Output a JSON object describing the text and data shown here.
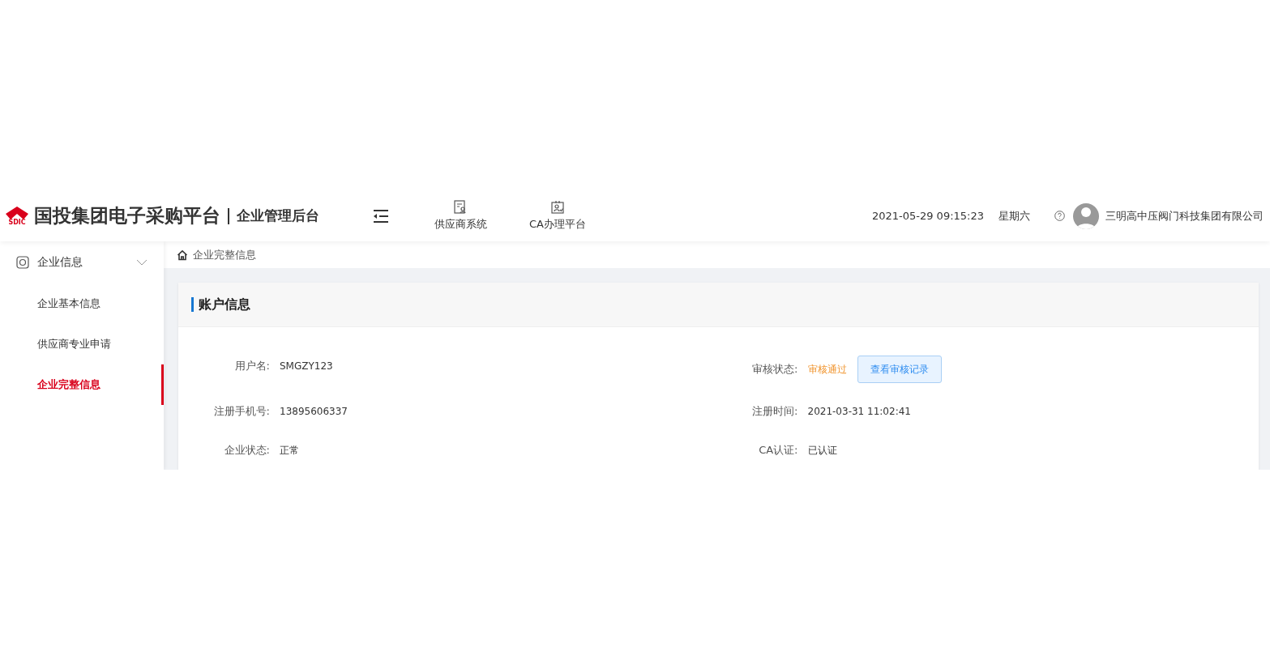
{
  "header": {
    "logo_text": "SDIC",
    "title": "国投集团电子采购平台",
    "subtitle": "企业管理后台",
    "nav": [
      {
        "label": "供应商系统",
        "kind": "supplier"
      },
      {
        "label": "CA办理平台",
        "kind": "ca"
      }
    ],
    "datetime": "2021-05-29 09:15:23",
    "weekday": "星期六",
    "company": "三明高中压阀门科技集团有限公司"
  },
  "sidebar": {
    "items": [
      {
        "label": "企业信息",
        "expanded": true,
        "children": [
          {
            "label": "企业基本信息",
            "selected": false
          },
          {
            "label": "供应商专业申请",
            "selected": false
          },
          {
            "label": "企业完整信息",
            "selected": true
          }
        ]
      }
    ]
  },
  "breadcrumb": "企业完整信息",
  "card": {
    "title": "账户信息",
    "fields": [
      {
        "label": "用户名:",
        "value": "SMGZY123",
        "kind": "text"
      },
      {
        "label": "审核状态:",
        "value": "审核通过",
        "kind": "status",
        "action": "查看审核记录"
      },
      {
        "label": "注册手机号:",
        "value": "13895606337",
        "kind": "text"
      },
      {
        "label": "注册时间:",
        "value": "2021-03-31 11:02:41",
        "kind": "text"
      },
      {
        "label": "企业状态:",
        "value": "正常",
        "kind": "text"
      },
      {
        "label": "CA认证:",
        "value": "已认证",
        "kind": "text"
      }
    ]
  }
}
